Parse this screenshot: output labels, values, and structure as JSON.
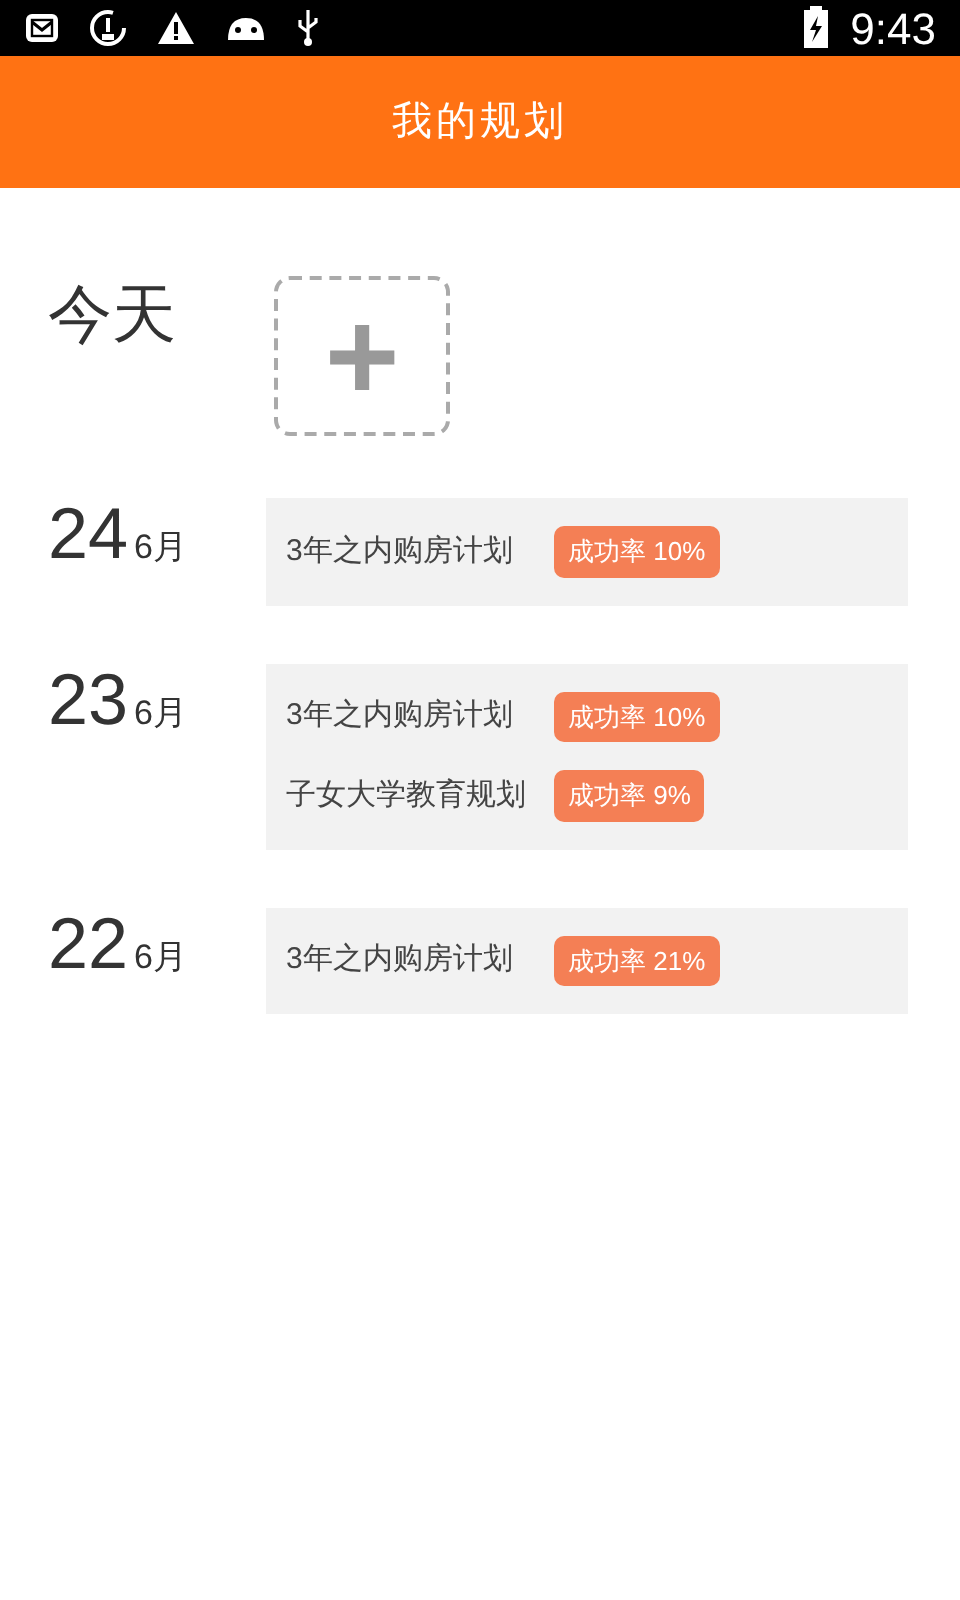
{
  "status_bar": {
    "time": "9:43"
  },
  "header": {
    "title": "我的规划"
  },
  "today": {
    "label": "今天",
    "add_button": "+"
  },
  "days": [
    {
      "day": "24",
      "month": "6月",
      "plans": [
        {
          "name": "3年之内购房计划",
          "badge": "成功率 10%"
        }
      ]
    },
    {
      "day": "23",
      "month": "6月",
      "plans": [
        {
          "name": "3年之内购房计划",
          "badge": "成功率 10%"
        },
        {
          "name": "子女大学教育规划",
          "badge": "成功率 9%"
        }
      ]
    },
    {
      "day": "22",
      "month": "6月",
      "plans": [
        {
          "name": "3年之内购房计划",
          "badge": "成功率 21%"
        }
      ]
    }
  ]
}
